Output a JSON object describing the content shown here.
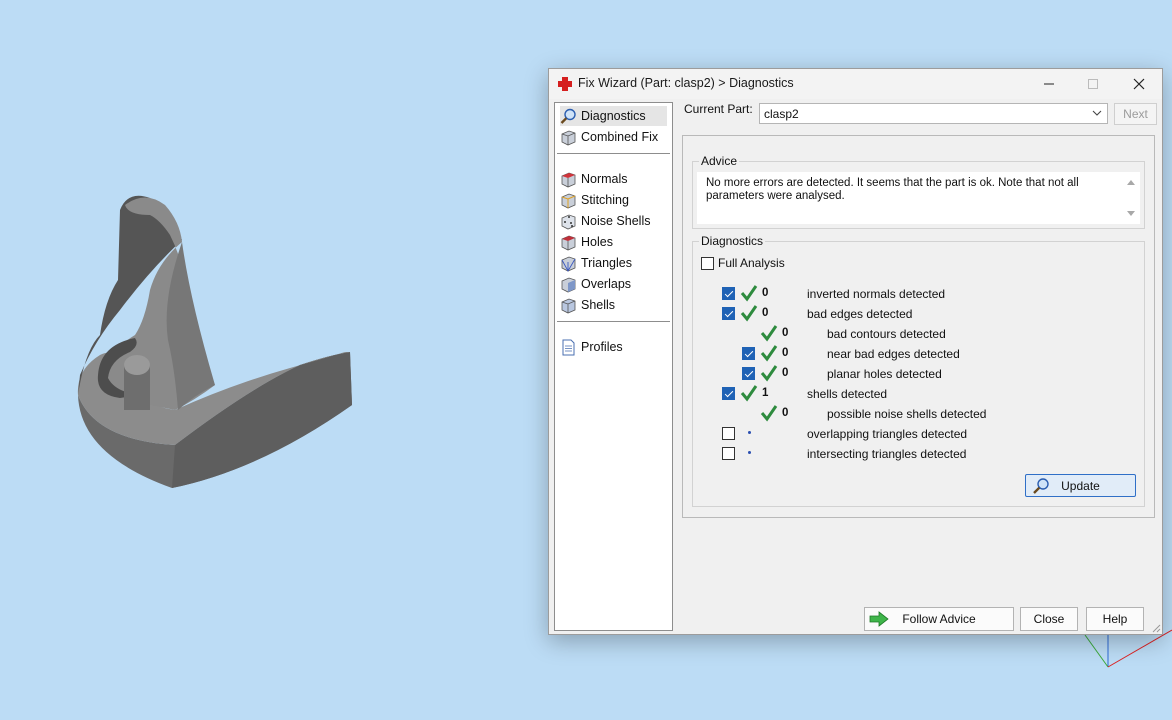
{
  "window": {
    "title": "Fix Wizard (Part: clasp2) > Diagnostics",
    "minimize_label": "─",
    "maximize_label": "☐",
    "close_label": "✕"
  },
  "sidebar": {
    "items": [
      {
        "label": "Diagnostics",
        "icon": "magnifier-icon"
      },
      {
        "label": "Combined Fix",
        "icon": "cube-icon"
      },
      {
        "label": "Normals",
        "icon": "cube-red-icon"
      },
      {
        "label": "Stitching",
        "icon": "cube-stitch-icon"
      },
      {
        "label": "Noise Shells",
        "icon": "cube-dots-icon"
      },
      {
        "label": "Holes",
        "icon": "cube-hole-icon"
      },
      {
        "label": "Triangles",
        "icon": "cube-triangle-icon"
      },
      {
        "label": "Overlaps",
        "icon": "cube-overlap-icon"
      },
      {
        "label": "Shells",
        "icon": "cube-shell-icon"
      },
      {
        "label": "Profiles",
        "icon": "document-icon"
      }
    ],
    "selected": "Diagnostics"
  },
  "current_part": {
    "label": "Current Part:",
    "value": "clasp2",
    "next_label": "Next"
  },
  "advice": {
    "title": "Advice",
    "text": "No more errors are detected. It seems that the part is ok. Note that not all parameters were analysed."
  },
  "diagnostics": {
    "title": "Diagnostics",
    "full_analysis_label": "Full Analysis",
    "full_analysis_checked": false,
    "rows": [
      {
        "checked": true,
        "status": "ok",
        "count": "0",
        "text": "inverted normals detected"
      },
      {
        "checked": true,
        "status": "ok",
        "count": "0",
        "text": "bad edges detected"
      },
      {
        "checked": null,
        "status": "ok",
        "count": "0",
        "text": "bad contours detected"
      },
      {
        "checked": true,
        "status": "ok",
        "count": "0",
        "text": "near bad edges detected"
      },
      {
        "checked": true,
        "status": "ok",
        "count": "0",
        "text": "planar holes detected"
      },
      {
        "checked": true,
        "status": "ok",
        "count": "1",
        "text": "shells detected"
      },
      {
        "checked": null,
        "status": "ok",
        "count": "0",
        "text": "possible noise shells detected"
      },
      {
        "checked": false,
        "status": "pending",
        "count": "",
        "text": "overlapping triangles detected"
      },
      {
        "checked": false,
        "status": "pending",
        "count": "",
        "text": "intersecting triangles detected"
      }
    ],
    "update_label": "Update"
  },
  "footer": {
    "follow_advice_label": "Follow Advice",
    "close_label": "Close",
    "help_label": "Help"
  },
  "colors": {
    "viewport_bg": "#bcdcf5",
    "check_green": "#2e8b3e",
    "checkbox_blue": "#1f62b5",
    "model_gray": "#7a7a7a"
  }
}
